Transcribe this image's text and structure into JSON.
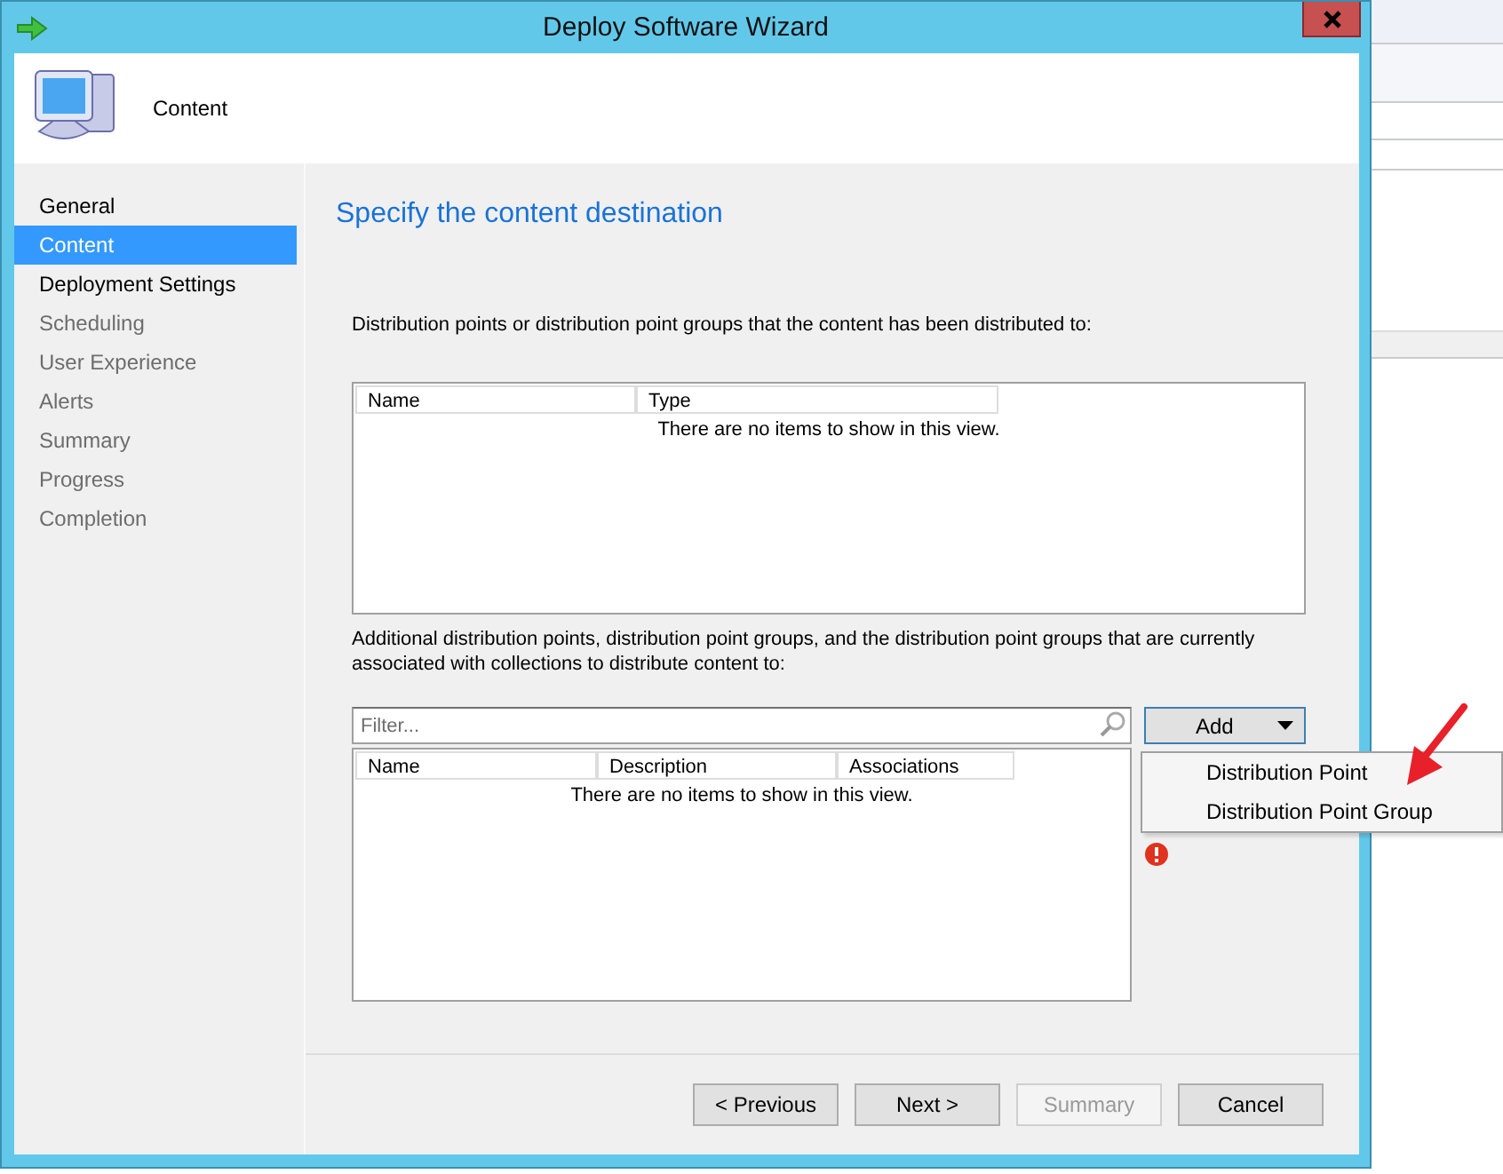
{
  "window": {
    "title": "Deploy Software Wizard"
  },
  "header": {
    "title": "Content"
  },
  "steps": [
    {
      "label": "General",
      "selected": false,
      "enabled": true
    },
    {
      "label": "Content",
      "selected": true,
      "enabled": true
    },
    {
      "label": "Deployment Settings",
      "selected": false,
      "enabled": true
    },
    {
      "label": "Scheduling",
      "selected": false,
      "enabled": false
    },
    {
      "label": "User Experience",
      "selected": false,
      "enabled": false
    },
    {
      "label": "Alerts",
      "selected": false,
      "enabled": false
    },
    {
      "label": "Summary",
      "selected": false,
      "enabled": false
    },
    {
      "label": "Progress",
      "selected": false,
      "enabled": false
    },
    {
      "label": "Completion",
      "selected": false,
      "enabled": false
    }
  ],
  "page": {
    "heading": "Specify the content destination"
  },
  "distributed": {
    "description": "Distribution points or distribution point groups that the content has been distributed to:",
    "columns": [
      "Name",
      "Type"
    ],
    "empty_message": "There are no items to show in this view."
  },
  "additional": {
    "description": "Additional distribution points, distribution point groups, and the distribution point groups that are currently associated with collections to distribute content to:",
    "filter": {
      "placeholder": "Filter..."
    },
    "columns": [
      "Name",
      "Description",
      "Associations"
    ],
    "empty_message": "There are no items to show in this view.",
    "add_button": "Add",
    "menu": [
      "Distribution Point",
      "Distribution Point Group"
    ]
  },
  "buttons": [
    {
      "label": "< Previous",
      "disabled": false
    },
    {
      "label": "Next >",
      "disabled": false
    },
    {
      "label": "Summary",
      "disabled": true
    },
    {
      "label": "Cancel",
      "disabled": false
    }
  ]
}
